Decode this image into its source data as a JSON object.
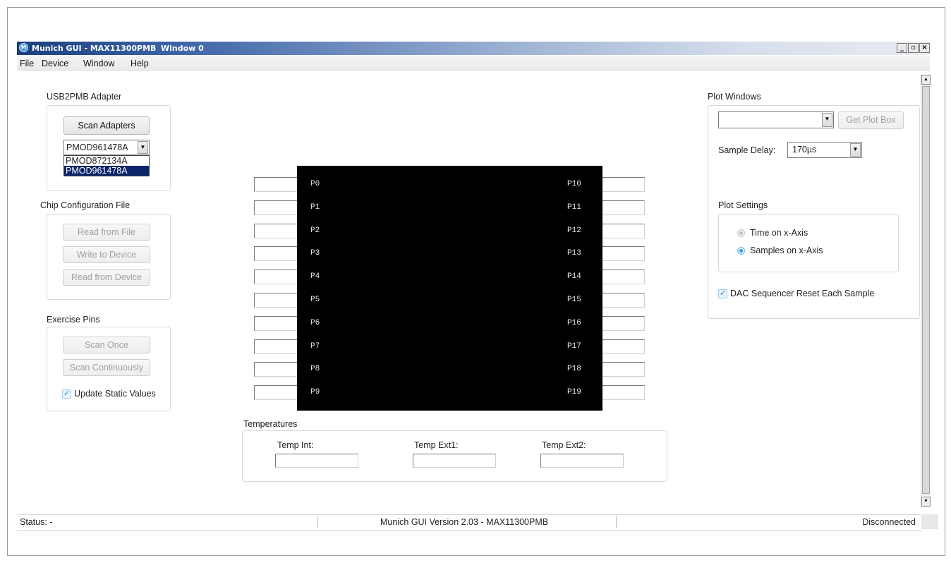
{
  "window": {
    "title": "Munich GUI - MAX11300PMB",
    "subtitle": "Window 0",
    "app_icon": "maxim-icon",
    "controls": [
      "_",
      "▫",
      "×"
    ]
  },
  "menu": [
    "File",
    "Device",
    "Window",
    "Help"
  ],
  "usb_adapter": {
    "heading": "USB2PMB Adapter",
    "scan_button": "Scan Adapters",
    "selected": "PMOD961478A",
    "options": [
      "PMOD872134A",
      "PMOD961478A"
    ]
  },
  "chip_config": {
    "heading": "Chip Configuration File",
    "read_file": "Read from File",
    "write_device": "Write to Device",
    "read_device": "Read from Device"
  },
  "exercise": {
    "heading": "Exercise Pins",
    "scan_once": "Scan Once",
    "scan_continuously": "Scan Continuously",
    "update_static": "Update Static Values"
  },
  "pins": {
    "left": [
      "P0",
      "P1",
      "P2",
      "P3",
      "P4",
      "P5",
      "P6",
      "P7",
      "P8",
      "P9"
    ],
    "right": [
      "P10",
      "P11",
      "P12",
      "P13",
      "P14",
      "P15",
      "P16",
      "P17",
      "P18",
      "P19"
    ]
  },
  "temperatures": {
    "heading": "Temperatures",
    "int": "Temp Int:",
    "ext1": "Temp Ext1:",
    "ext2": "Temp Ext2:"
  },
  "plot": {
    "heading": "Plot Windows",
    "get_plot_box": "Get Plot Box",
    "sample_delay_label": "Sample Delay:",
    "sample_delay_value": "170µs",
    "settings_heading": "Plot Settings",
    "time_axis": "Time on x-Axis",
    "samples_axis": "Samples on x-Axis",
    "dac_reset": "DAC Sequencer Reset Each Sample"
  },
  "status": {
    "left": "Status: -",
    "center": "Munich GUI Version 2.03 - MAX11300PMB",
    "right": "Disconnected"
  }
}
